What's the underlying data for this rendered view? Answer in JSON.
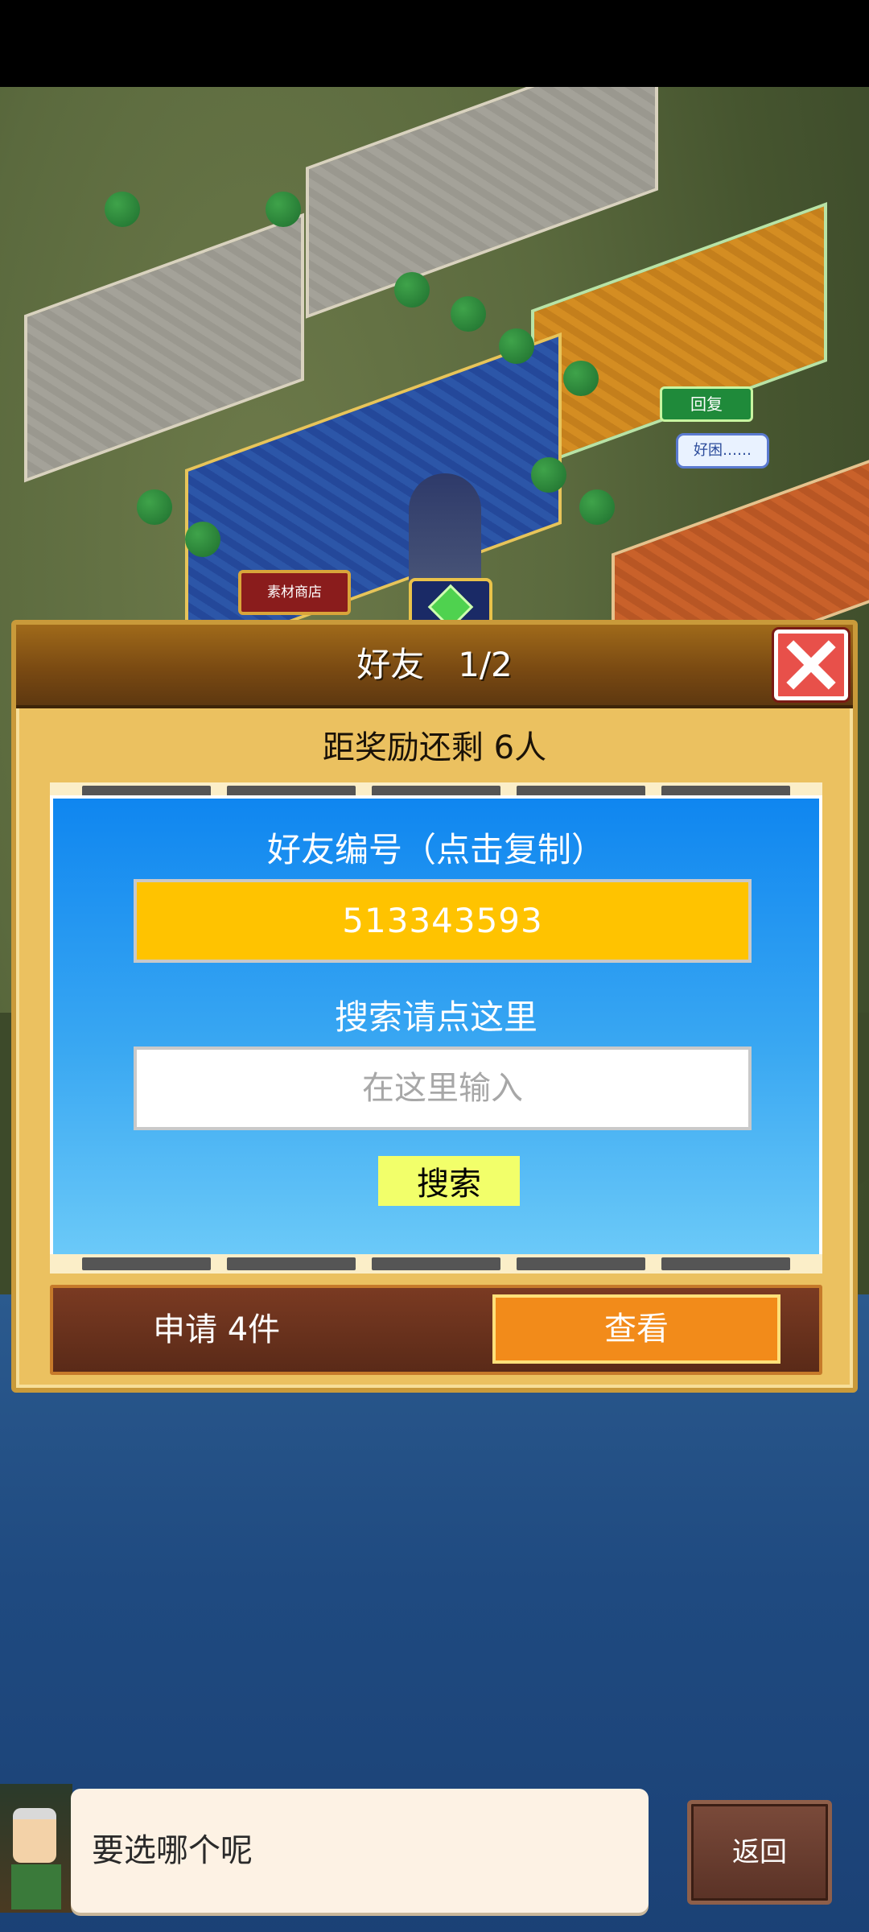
{
  "scene": {
    "material_shop_label": "素材商店",
    "reply_bubble": "回复",
    "good_bubble": "好困……"
  },
  "dialog": {
    "title": "好友　1/2",
    "reward_text": "距奖励还剩 6人",
    "id_label": "好友编号（点击复制）",
    "friend_id": "513343593",
    "search_label": "搜索请点这里",
    "search_placeholder": "在这里输入",
    "search_button": "搜索",
    "request_text": "申请 4件",
    "view_button": "查看"
  },
  "bottom": {
    "message": "要选哪个呢",
    "back_button": "返回"
  },
  "colors": {
    "dialog_bg": "#ebc160",
    "header": "#7a4a12",
    "panel_blue": "#0f86f0",
    "id_field": "#ffc300",
    "search_button": "#f2ff6a",
    "view_button": "#f28b1a",
    "close_button": "#e8504a"
  },
  "icons": {
    "close": "close-icon",
    "prev": "arrow-left-icon",
    "next": "arrow-right-icon",
    "gem": "gem-icon"
  }
}
